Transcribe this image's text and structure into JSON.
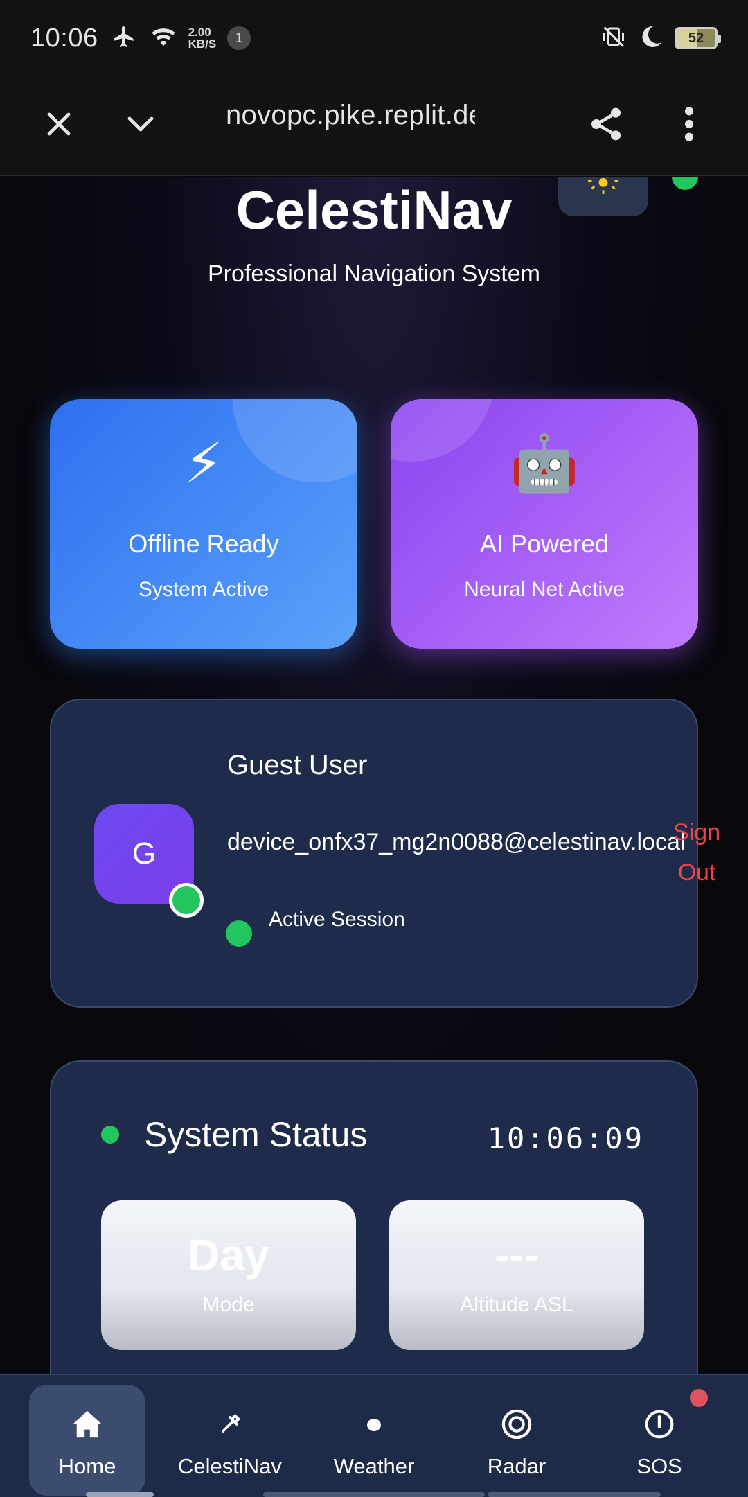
{
  "status_bar": {
    "time": "10:06",
    "net_speed_value": "2.00",
    "net_speed_unit": "KB/S",
    "notification_count": "1",
    "battery": "52"
  },
  "browser": {
    "url": "novopc.pike.replit.dev"
  },
  "header": {
    "title": "CelestiNav",
    "subtitle": "Professional Navigation System"
  },
  "features": [
    {
      "icon": "⚡",
      "icon_name": "lightning-icon",
      "title": "Offline Ready",
      "subtitle": "System Active",
      "color": "#3b82f6"
    },
    {
      "icon": "🤖",
      "icon_name": "robot-icon",
      "title": "AI Powered",
      "subtitle": "Neural Net Active",
      "color": "#a855f7"
    }
  ],
  "user": {
    "avatar_letter": "G",
    "name": "Guest User",
    "email": "device_onfx37_mg2n0088@celestinav.local",
    "session": "Active Session",
    "sign_out": "Sign Out"
  },
  "system_status": {
    "title": "System Status",
    "clock": "10:06:09",
    "tiles": [
      {
        "value": "Day",
        "label": "Mode"
      },
      {
        "value": "---",
        "label": "Altitude ASL"
      }
    ]
  },
  "nav": {
    "items": [
      {
        "label": "Home",
        "icon": "home-icon",
        "active": true
      },
      {
        "label": "CelestiNav",
        "icon": "sextant-icon",
        "active": false
      },
      {
        "label": "Weather",
        "icon": "weather-icon",
        "active": false
      },
      {
        "label": "Radar",
        "icon": "radar-icon",
        "active": false
      },
      {
        "label": "SOS",
        "icon": "sos-icon",
        "active": false
      }
    ]
  },
  "colors": {
    "accent_green": "#22c55e",
    "sign_out_red": "#ef4444",
    "card_bg": "#1f2b4a"
  }
}
